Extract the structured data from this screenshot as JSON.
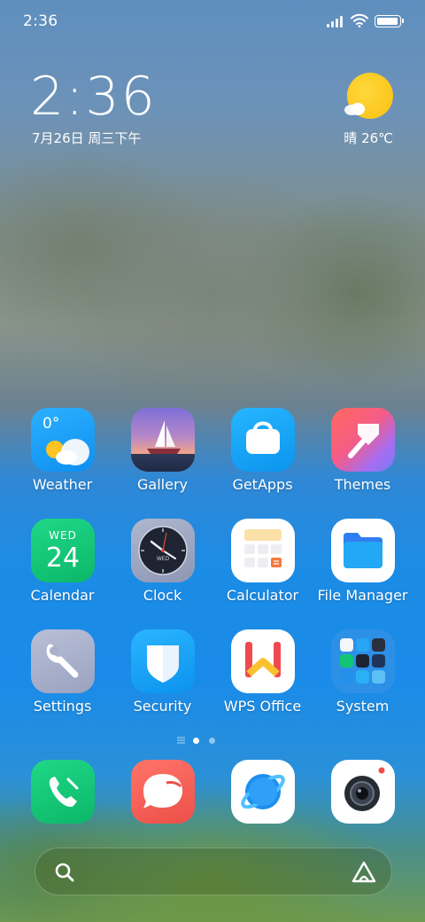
{
  "status_bar": {
    "time": "2:36",
    "battery_level": 1.0
  },
  "clock_widget": {
    "time": "2:36",
    "date": "7月26日 周三下午"
  },
  "weather_widget": {
    "icon": "sun-cloud-icon",
    "text": "晴 26℃"
  },
  "apps": [
    {
      "label": "Weather",
      "icon": "weather-icon",
      "badge_text": "0°"
    },
    {
      "label": "Gallery",
      "icon": "gallery-icon"
    },
    {
      "label": "GetApps",
      "icon": "getapps-icon"
    },
    {
      "label": "Themes",
      "icon": "themes-icon"
    },
    {
      "label": "Calendar",
      "icon": "calendar-icon",
      "weekday": "WED",
      "day": "24"
    },
    {
      "label": "Clock",
      "icon": "clock-icon",
      "weekday": "WED"
    },
    {
      "label": "Calculator",
      "icon": "calculator-icon"
    },
    {
      "label": "File Manager",
      "icon": "file-manager-icon"
    },
    {
      "label": "Settings",
      "icon": "settings-icon"
    },
    {
      "label": "Security",
      "icon": "security-icon"
    },
    {
      "label": "WPS Office",
      "icon": "wps-office-icon"
    },
    {
      "label": "System",
      "icon": "system-folder-icon"
    }
  ],
  "pager": {
    "pages": 2,
    "current": 1
  },
  "dock": [
    {
      "icon": "phone-icon"
    },
    {
      "icon": "messages-icon"
    },
    {
      "icon": "browser-icon"
    },
    {
      "icon": "camera-icon"
    }
  ],
  "search_bar": {
    "left_icon": "search-icon",
    "right_icon": "assistant-icon"
  },
  "colors": {
    "weather_bg": "#1fa2f2",
    "getapps_bg": "#18a4f0",
    "calendar_bg": "#10c775",
    "phone_bg": "#12c574",
    "messages_bg": "#f2625a",
    "sun": "#fbc422"
  }
}
